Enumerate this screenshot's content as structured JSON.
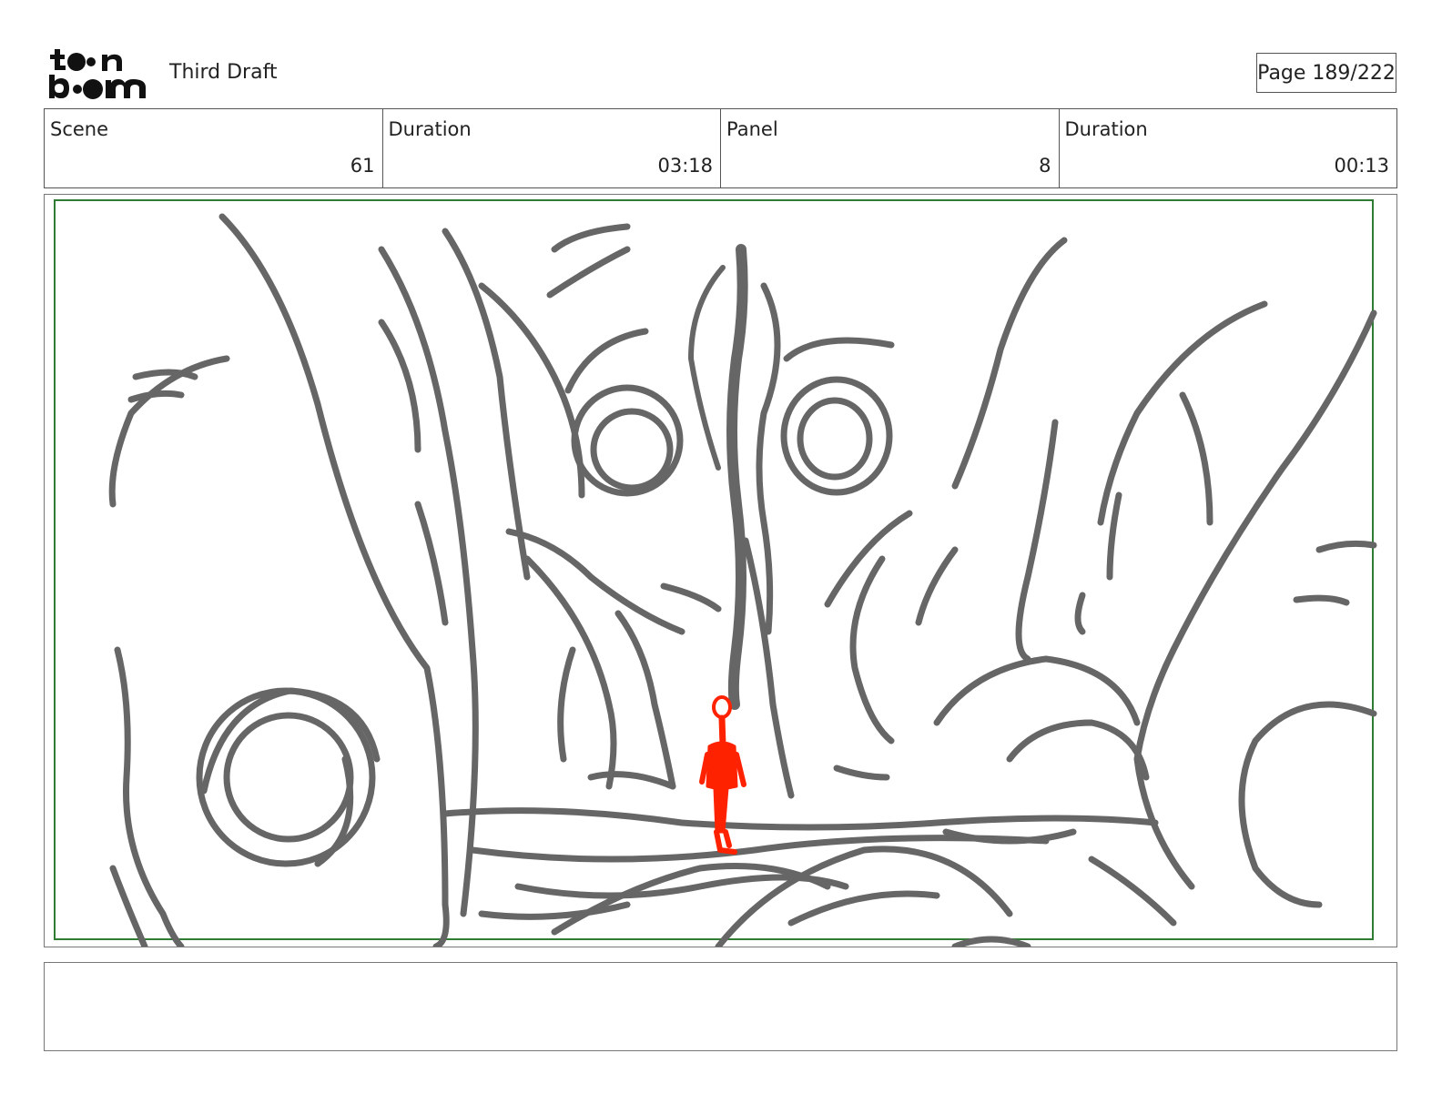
{
  "header": {
    "logo_text": "toon boom",
    "title": "Third Draft",
    "page_label": "Page 189/222"
  },
  "info": {
    "scene_label": "Scene",
    "scene_value": "61",
    "scene_duration_label": "Duration",
    "scene_duration_value": "03:18",
    "panel_label": "Panel",
    "panel_value": "8",
    "panel_duration_label": "Duration",
    "panel_duration_value": "00:13"
  },
  "colors": {
    "sketch": "#666666",
    "figure": "#ff2200",
    "safe_frame": "#2e7d32"
  },
  "notes": {
    "text": ""
  }
}
